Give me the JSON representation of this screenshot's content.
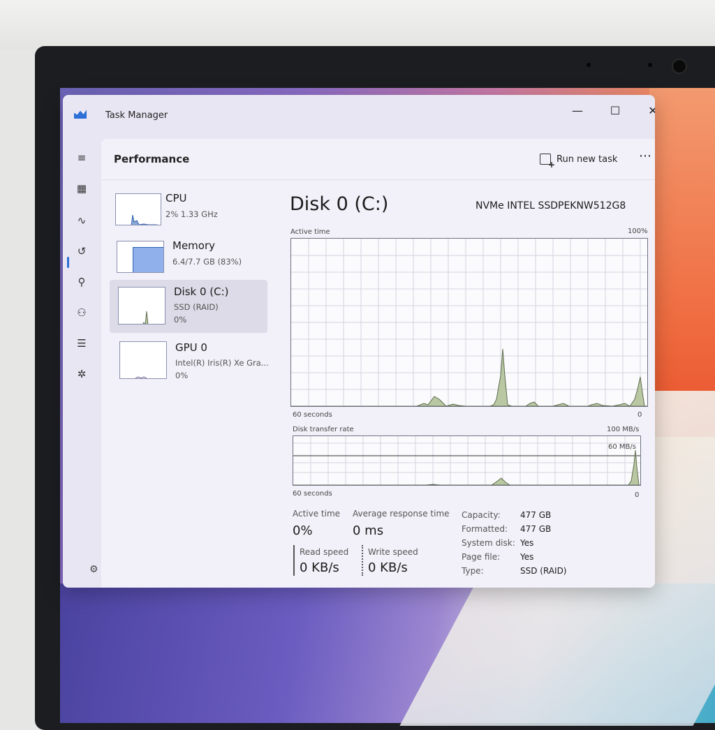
{
  "window": {
    "title": "Task Manager",
    "min": "—",
    "max": "☐",
    "close": "✕"
  },
  "header": {
    "title": "Performance",
    "run_new_task": "Run new task",
    "more": "⋯"
  },
  "rail": [
    "≡",
    "▦",
    "∿",
    "↺",
    "⚲",
    "⚇",
    "☰",
    "✲"
  ],
  "settings_icon": "⚙",
  "devices": [
    {
      "name": "CPU",
      "sub1": "2%  1.33 GHz",
      "sub2": ""
    },
    {
      "name": "Memory",
      "sub1": "6.4/7.7 GB (83%)",
      "sub2": ""
    },
    {
      "name": "Disk 0 (C:)",
      "sub1": "SSD (RAID)",
      "sub2": "0%"
    },
    {
      "name": "GPU 0",
      "sub1": "Intel(R) Iris(R) Xe Gra...",
      "sub2": "0%"
    }
  ],
  "disk": {
    "title": "Disk 0 (C:)",
    "model": "NVMe INTEL SSDPEKNW512G8",
    "active_time_label": "Active time",
    "active_time_max": "100%",
    "graph1_left": "60 seconds",
    "graph1_right": "0",
    "transfer_label": "Disk transfer rate",
    "transfer_max": "100 MB/s",
    "transfer_line": "60 MB/s",
    "graph2_left": "60 seconds",
    "graph2_right": "0"
  },
  "stats": {
    "active_time_label": "Active time",
    "active_time_value": "0%",
    "avg_resp_label": "Average response time",
    "avg_resp_value": "0 ms",
    "read_label": "Read speed",
    "read_value": "0 KB/s",
    "write_label": "Write speed",
    "write_value": "0 KB/s"
  },
  "props": [
    {
      "k": "Capacity:",
      "v": "477 GB"
    },
    {
      "k": "Formatted:",
      "v": "477 GB"
    },
    {
      "k": "System disk:",
      "v": "Yes"
    },
    {
      "k": "Page file:",
      "v": "Yes"
    },
    {
      "k": "Type:",
      "v": "SSD (RAID)"
    }
  ],
  "colors": {
    "accent": "#2c6fd6",
    "graph_fill": "#b9c8a3",
    "graph_line": "#5f6c4f"
  }
}
